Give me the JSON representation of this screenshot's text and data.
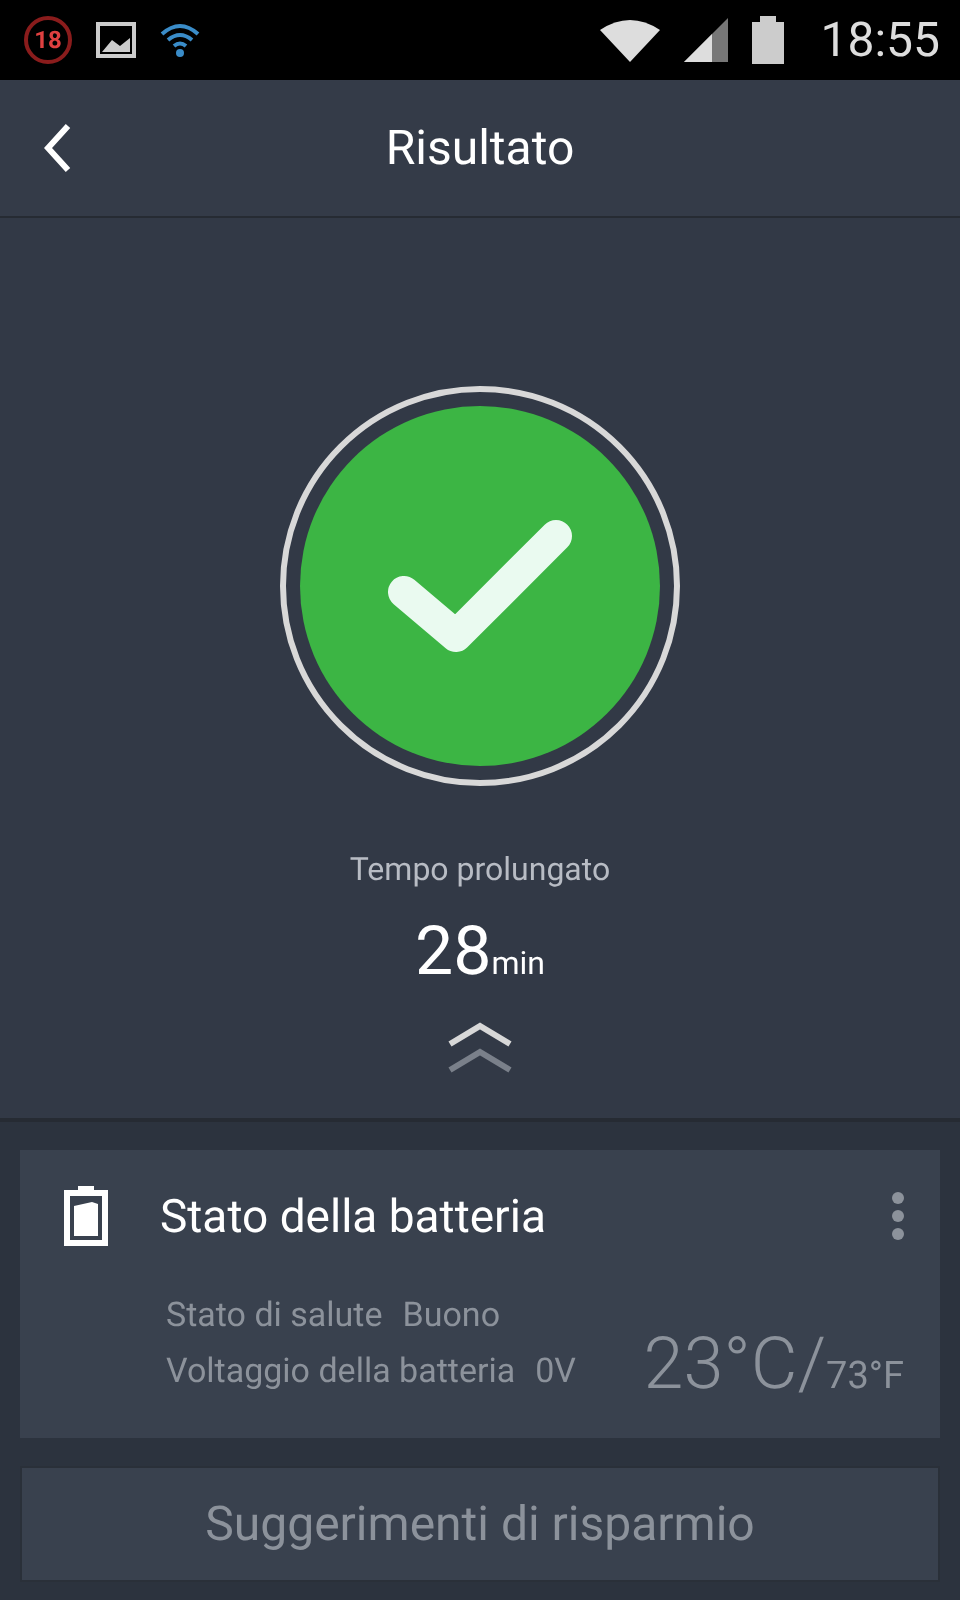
{
  "status_bar": {
    "notification_count": "18",
    "time": "18:55"
  },
  "header": {
    "title": "Risultato"
  },
  "result": {
    "label": "Tempo prolungato",
    "value": "28",
    "unit": "min"
  },
  "battery_card": {
    "title": "Stato della batteria",
    "rows": [
      {
        "label": "Stato di salute",
        "value": "Buono"
      },
      {
        "label": "Voltaggio della batteria",
        "value": "0V"
      }
    ],
    "temperature_c": "23°C/",
    "temperature_f": "73°F"
  },
  "tips_button": {
    "label": "Suggerimenti di risparmio"
  }
}
